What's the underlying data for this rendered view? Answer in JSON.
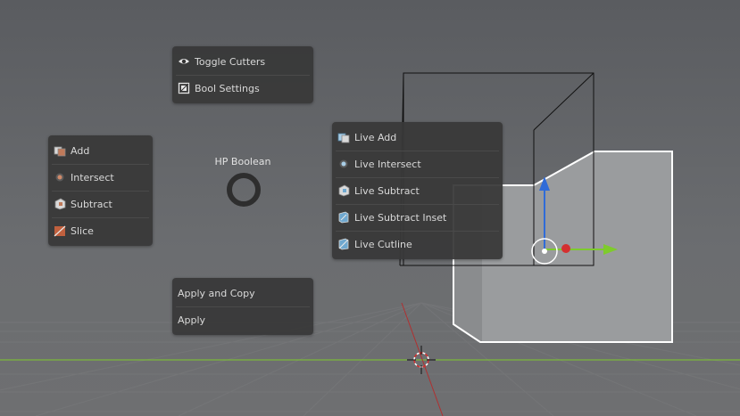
{
  "pie": {
    "title": "HP Boolean"
  },
  "menus": {
    "top": [
      {
        "label": "Toggle Cutters",
        "icon": "eye-icon"
      },
      {
        "label": "Bool Settings",
        "icon": "settings-icon"
      }
    ],
    "left": [
      {
        "label": "Add",
        "icon": "add-icon"
      },
      {
        "label": "Intersect",
        "icon": "intersect-icon"
      },
      {
        "label": "Subtract",
        "icon": "subtract-icon"
      },
      {
        "label": "Slice",
        "icon": "slice-icon"
      }
    ],
    "right": [
      {
        "label": "Live Add",
        "icon": "live-add-icon"
      },
      {
        "label": "Live Intersect",
        "icon": "live-intersect-icon"
      },
      {
        "label": "Live Subtract",
        "icon": "live-subtract-icon"
      },
      {
        "label": "Live Subtract Inset",
        "icon": "live-subtract-inset-icon"
      },
      {
        "label": "Live Cutline",
        "icon": "live-cutline-icon"
      }
    ],
    "bottom": [
      {
        "label": "Apply and Copy"
      },
      {
        "label": "Apply"
      }
    ]
  },
  "colors": {
    "menu_bg": "#383838",
    "menu_text": "#d9d9d9",
    "axis_x": "#d43030",
    "axis_y": "#7ecb2c",
    "axis_z": "#2f6bd8",
    "object": "#9a9c9e",
    "selection_outline": "#ffffff"
  }
}
